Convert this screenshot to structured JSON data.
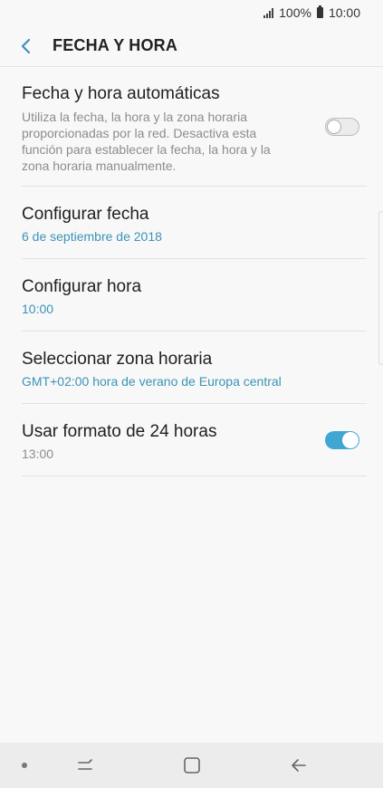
{
  "status_bar": {
    "battery_text": "100%",
    "time": "10:00",
    "icons": [
      "signal-icon",
      "battery-icon"
    ]
  },
  "header": {
    "title": "FECHA Y HORA",
    "back_icon": "back-chevron-icon"
  },
  "settings": [
    {
      "title": "Fecha y hora automáticas",
      "description": "Utiliza la fecha, la hora y la zona horaria proporcionadas por la red. Desactiva esta función para establecer la fecha, la hora y la zona horaria manualmente.",
      "toggle_on": false
    },
    {
      "title": "Configurar fecha",
      "value": "6 de septiembre de 2018"
    },
    {
      "title": "Configurar hora",
      "value": "10:00"
    },
    {
      "title": "Seleccionar zona horaria",
      "value": "GMT+02:00 hora de verano de Europa central"
    },
    {
      "title": "Usar formato de 24 horas",
      "value": "13:00",
      "toggle_on": true
    }
  ],
  "nav_bar": {
    "icons": [
      "recent-apps-icon",
      "home-icon",
      "back-arrow-icon"
    ]
  },
  "colors": {
    "accent": "#3b93b7",
    "toggle_on": "#3fa7d1",
    "background": "#f8f8f8"
  }
}
